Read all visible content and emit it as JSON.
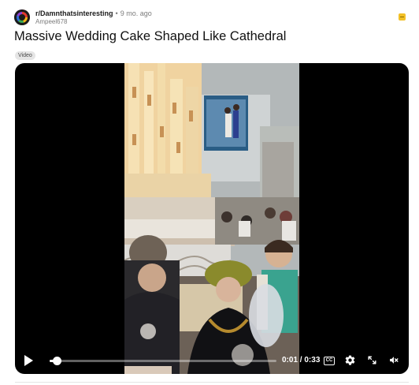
{
  "post": {
    "subreddit": "r/Damnthatsinteresting",
    "separator": "•",
    "age": "9 mo. ago",
    "author": "Ampeel678",
    "title": "Massive Wedding Cake Shaped Like Cathedral",
    "flair": "Video"
  },
  "player": {
    "current_time": "0:01",
    "duration": "0:33",
    "time_separator": " / ",
    "cc_label": "CC",
    "progress": 0.03,
    "muted": true
  },
  "icons": {
    "award": "award-icon",
    "play": "play-icon",
    "settings": "gear-icon",
    "fullscreen": "fullscreen-icon",
    "mute": "speaker-muted-icon"
  },
  "colors": {
    "player_background": "#000000",
    "award": "#f2c027",
    "flair_background": "#e5e5e5"
  }
}
